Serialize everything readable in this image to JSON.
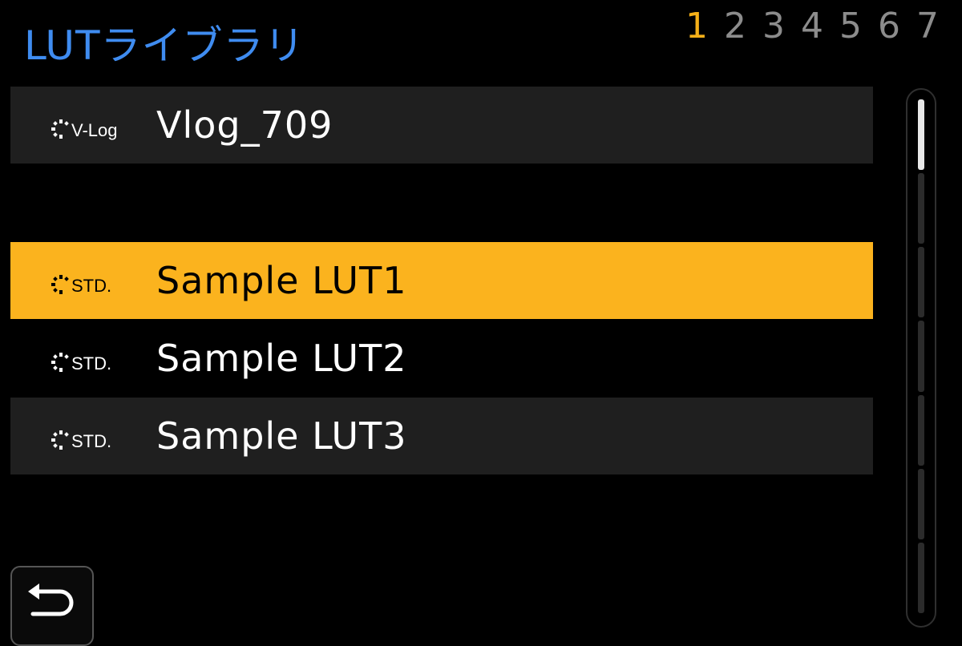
{
  "header": {
    "title": "LUTライブラリ",
    "pages": [
      "1",
      "2",
      "3",
      "4",
      "5",
      "6",
      "7"
    ],
    "active_page": "1"
  },
  "list": {
    "items": [
      {
        "tag": "V-Log",
        "name": "Vlog_709",
        "state": "filled"
      },
      {
        "tag": "",
        "name": "",
        "state": "empty"
      },
      {
        "tag": "STD.",
        "name": "Sample LUT1",
        "state": "selected"
      },
      {
        "tag": "STD.",
        "name": "Sample LUT2",
        "state": "empty"
      },
      {
        "tag": "STD.",
        "name": "Sample LUT3",
        "state": "filled"
      }
    ]
  },
  "scrollbar": {
    "segments": 7,
    "thumb_index": 0
  },
  "colors": {
    "title": "#3f8cf0",
    "active_page": "#f5b018",
    "selected_row": "#fbb31e",
    "row_bg": "#1f1f1f"
  },
  "icons": {
    "lut": "lut-sparkle-icon",
    "back": "return-arrow-icon"
  }
}
